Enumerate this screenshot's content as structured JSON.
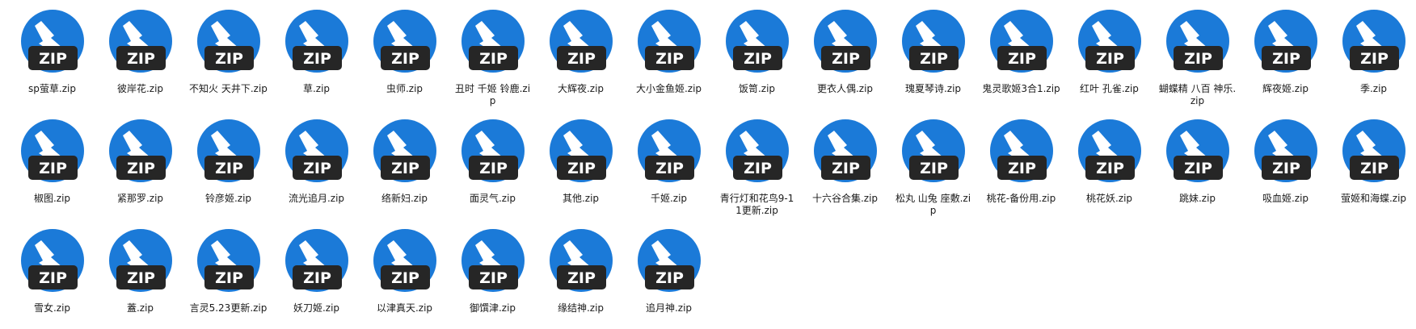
{
  "icon": {
    "name": "zip-file-icon",
    "badge_text": "ZIP",
    "colors": {
      "circle": "#1b7ad8",
      "bolt": "#ffffff",
      "badge": "#262626",
      "badge_text": "#ffffff"
    }
  },
  "files": [
    {
      "name": "sp萤草.zip"
    },
    {
      "name": "彼岸花.zip"
    },
    {
      "name": "不知火 天井下.zip"
    },
    {
      "name": "草.zip"
    },
    {
      "name": "虫师.zip"
    },
    {
      "name": "丑时 千姬 铃鹿.zip"
    },
    {
      "name": "大辉夜.zip"
    },
    {
      "name": "大小金鱼姬.zip"
    },
    {
      "name": "饭笥.zip"
    },
    {
      "name": "更衣人偶.zip"
    },
    {
      "name": "瑰夏琴诗.zip"
    },
    {
      "name": "鬼灵歌姬3合1.zip"
    },
    {
      "name": "红叶 孔雀.zip"
    },
    {
      "name": "蝴蝶精 八百 神乐.zip"
    },
    {
      "name": "辉夜姬.zip"
    },
    {
      "name": "季.zip"
    },
    {
      "name": "椒图.zip"
    },
    {
      "name": "紧那罗.zip"
    },
    {
      "name": "铃彦姬.zip"
    },
    {
      "name": "流光追月.zip"
    },
    {
      "name": "络新妇.zip"
    },
    {
      "name": "面灵气.zip"
    },
    {
      "name": "其他.zip"
    },
    {
      "name": "千姬.zip"
    },
    {
      "name": "青行灯和花鸟9-11更新.zip"
    },
    {
      "name": "十六谷合集.zip"
    },
    {
      "name": "松丸 山兔 座敷.zip"
    },
    {
      "name": "桃花-备份用.zip"
    },
    {
      "name": "桃花妖.zip"
    },
    {
      "name": "跳妹.zip"
    },
    {
      "name": "吸血姬.zip"
    },
    {
      "name": "萤姬和海蝶.zip"
    },
    {
      "name": "雪女.zip"
    },
    {
      "name": "蓋.zip"
    },
    {
      "name": "言灵5.23更新.zip"
    },
    {
      "name": "妖刀姬.zip"
    },
    {
      "name": "以津真天.zip"
    },
    {
      "name": "御馔津.zip"
    },
    {
      "name": "缘结神.zip"
    },
    {
      "name": "追月神.zip"
    }
  ]
}
